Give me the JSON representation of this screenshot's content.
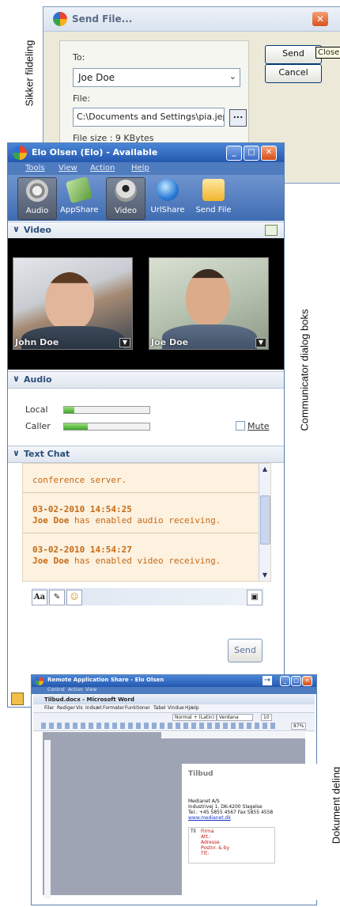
{
  "side_labels": {
    "top": "Sikker fildeling",
    "middle": "Communicator dialog boks",
    "bottom": "Dokument deling"
  },
  "send_file": {
    "title": "Send File...",
    "to_label": "To:",
    "to_value": "Joe Doe",
    "file_label": "File:",
    "file_value": "C:\\Documents and Settings\\pia.jeppe:",
    "browse_label": "...",
    "file_size": "File size :  9 KBytes",
    "send_label": "Send",
    "cancel_label": "Cancel",
    "tooltip": "Close",
    "close_glyph": "✕"
  },
  "communicator": {
    "title": "Elo Olsen (Elo) - Available",
    "menu": [
      "Tools",
      "View",
      "Action",
      "Help"
    ],
    "toolbar": [
      {
        "label": "Audio",
        "icon": "speaker-icon",
        "active": true
      },
      {
        "label": "AppShare",
        "icon": "appshare-icon",
        "active": false
      },
      {
        "label": "Video",
        "icon": "webcam-icon",
        "active": true
      },
      {
        "label": "UrlShare",
        "icon": "globe-icon",
        "active": false
      },
      {
        "label": "Send File",
        "icon": "send-file-icon",
        "active": false
      }
    ],
    "video_section": "Video",
    "video_left_name": "John Doe",
    "video_right_name": "Joe Doe",
    "audio_section": "Audio",
    "audio_local_label": "Local",
    "audio_caller_label": "Caller",
    "audio_local_level": 0.12,
    "audio_caller_level": 0.28,
    "mute_label": "Mute",
    "text_chat_section": "Text Chat",
    "chat_messages": [
      {
        "time": "",
        "line1": "conference server."
      },
      {
        "time": "03-02-2010 14:54:25",
        "name": "Joe Doe",
        "line1": "has enabled audio receiving."
      },
      {
        "time": "03-02-2010 14:54:27",
        "name": "Joe Doe",
        "line1": "has enabled video receiving."
      }
    ],
    "font_button": "Aa",
    "send_label": "Send"
  },
  "remote_share": {
    "title": "Remote Application Share - Elo Olsen",
    "menu": [
      "Control",
      "Action",
      "View"
    ],
    "word_title": "Tilbud.docx - Microsoft Word",
    "word_menu": [
      "Filer",
      "Rediger",
      "Vis",
      "Indsæt",
      "Formater",
      "Funktioner",
      "Tabel",
      "Vindue",
      "Hjælp"
    ],
    "style_value": "Normal + (Latin)",
    "font_value": "Verdana",
    "size_value": "10",
    "zoom_value": "87%",
    "doc_heading": "Tilbud",
    "doc_company": "Medianet A/S",
    "doc_address": "Industrivej 1, DK-4200 Slagelse",
    "doc_phone": "Tel.: +45 5855 4567 Fax 5855 4558",
    "doc_web": "www.medianet.dk",
    "doc_to": "Til",
    "doc_fields": [
      "Firma",
      "Att.:",
      "Adresse",
      "Postnr. & by",
      "Tlf.:"
    ]
  },
  "colors": {
    "accent_blue": "#2458b0",
    "chat_text": "#c56a16",
    "chat_bg": "#fdf1df",
    "close_orange": "#d9531e"
  }
}
